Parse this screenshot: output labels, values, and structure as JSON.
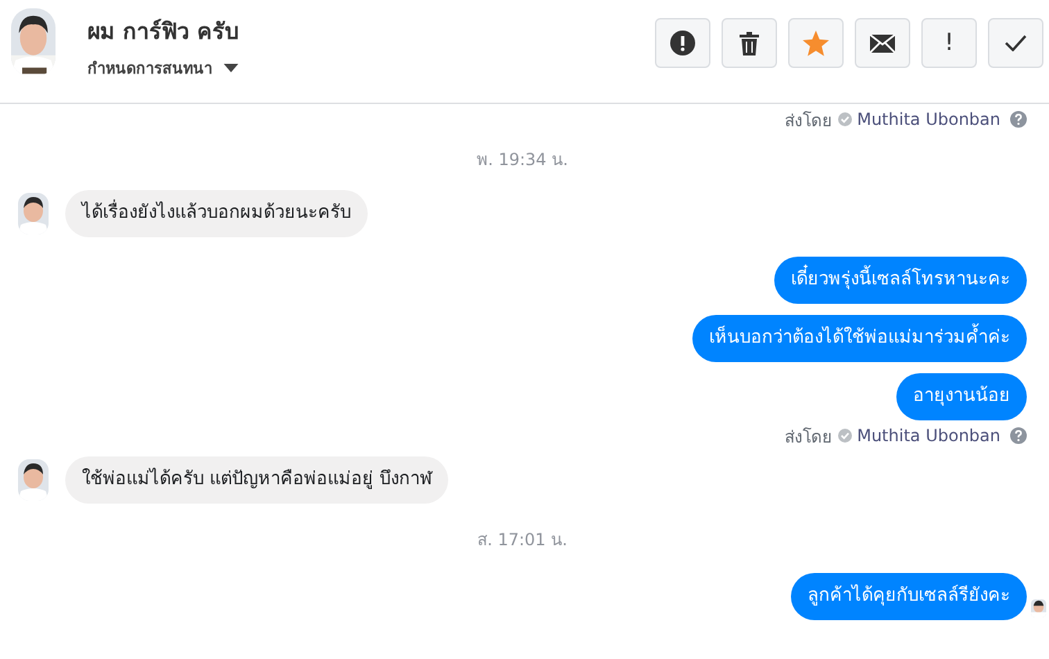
{
  "header": {
    "name": "ผม การ์ฟิว ครับ",
    "subtitle": "กำหนดการสนทนา"
  },
  "actions": [
    {
      "kind": "alert"
    },
    {
      "kind": "trash"
    },
    {
      "kind": "star",
      "on": true
    },
    {
      "kind": "mail"
    },
    {
      "kind": "text",
      "label": "!"
    },
    {
      "kind": "check"
    }
  ],
  "messages": [
    {
      "kind": "sent_by",
      "prefix": "ส่งโดย",
      "sender": "Muthita Ubonban"
    },
    {
      "kind": "timestamp",
      "text": "พ. 19:34 น."
    },
    {
      "kind": "incoming",
      "text": "ได้เรื่องยังไงแล้วบอกผมด้วยนะครับ"
    },
    {
      "kind": "outgoing",
      "text": "เดี๋ยวพรุ่งนี้เซลล์โทรหานะคะ"
    },
    {
      "kind": "outgoing",
      "text": "เห็นบอกว่าต้องได้ใช้พ่อแม่มาร่วมค้ำค่ะ"
    },
    {
      "kind": "outgoing",
      "text": "อายุงานน้อย"
    },
    {
      "kind": "sent_by",
      "prefix": "ส่งโดย",
      "sender": "Muthita Ubonban"
    },
    {
      "kind": "incoming",
      "text": "ใช้พ่อแม่ได้ครับ แต่ปัญหาคือพ่อแม่อยู่ บึงกาฬ"
    },
    {
      "kind": "timestamp",
      "text": "ส. 17:01 น."
    },
    {
      "kind": "outgoing",
      "text": "ลูกค้าได้คุยกับเซลล์รียังคะ",
      "seen": true
    }
  ]
}
